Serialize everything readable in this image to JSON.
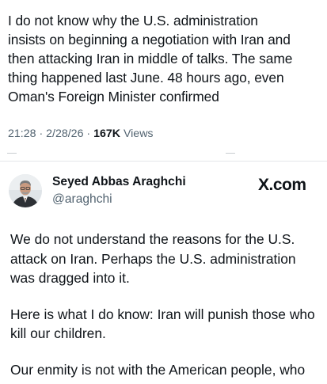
{
  "quoted_tweet": {
    "text": "I do not know why the U.S. administration\ninsists on beginning a negotiation with Iran and\nthen attacking Iran in middle of talks. The same\nthing happened last June. 48 hours ago, even\nOman's Foreign Minister confirmed",
    "meta": {
      "time": "21:28",
      "separator_1": " · ",
      "date": "2/28/26",
      "separator_2": " · ",
      "views_count": "167K",
      "views_label": " Views"
    }
  },
  "tweet": {
    "author": {
      "name": "Seyed Abbas Araghchi",
      "handle": "@araghchi"
    },
    "source_logo": "X.com",
    "paragraphs": [
      "We do not understand the reasons for the U.S. attack on Iran. Perhaps the U.S. administration was dragged into it.",
      "Here is what I do know: Iran will punish those who kill our children.",
      "Our enmity is not with the American people, who"
    ]
  },
  "icons": {
    "avatar": "profile-photo"
  },
  "colors": {
    "text_primary": "#0f1419",
    "text_secondary": "#536471",
    "divider": "#e4e7ea"
  }
}
